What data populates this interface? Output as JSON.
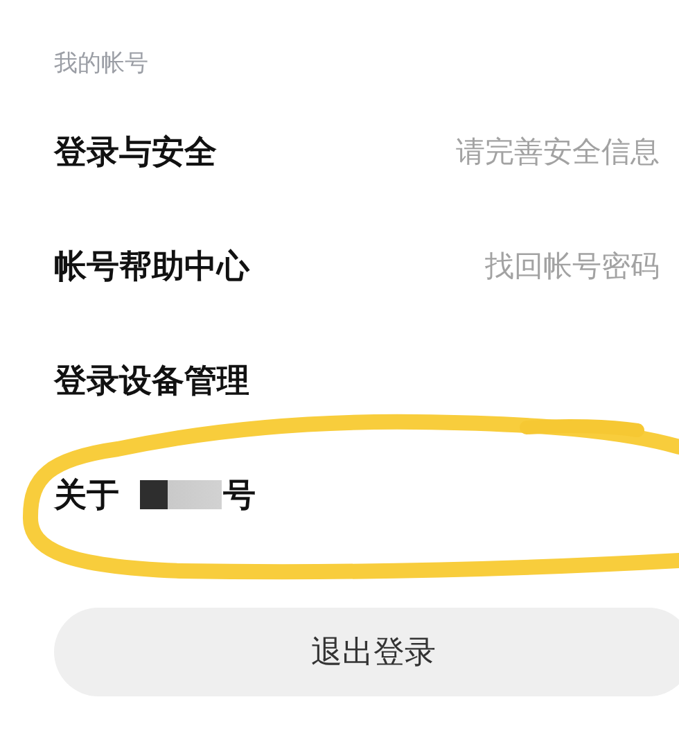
{
  "section_title": "我的帐号",
  "account_rows": [
    {
      "label": "登录与安全",
      "hint": "请完善安全信息",
      "redacted": false
    },
    {
      "label": "帐号帮助中心",
      "hint": "找回帐号密码",
      "redacted": false
    },
    {
      "label": "登录设备管理",
      "redacted": false
    },
    {
      "label": "关于",
      "label_end": "号",
      "redacted": true
    }
  ],
  "annotation": {
    "kind": "ellipse"
  },
  "logout_button": "退出登录"
}
